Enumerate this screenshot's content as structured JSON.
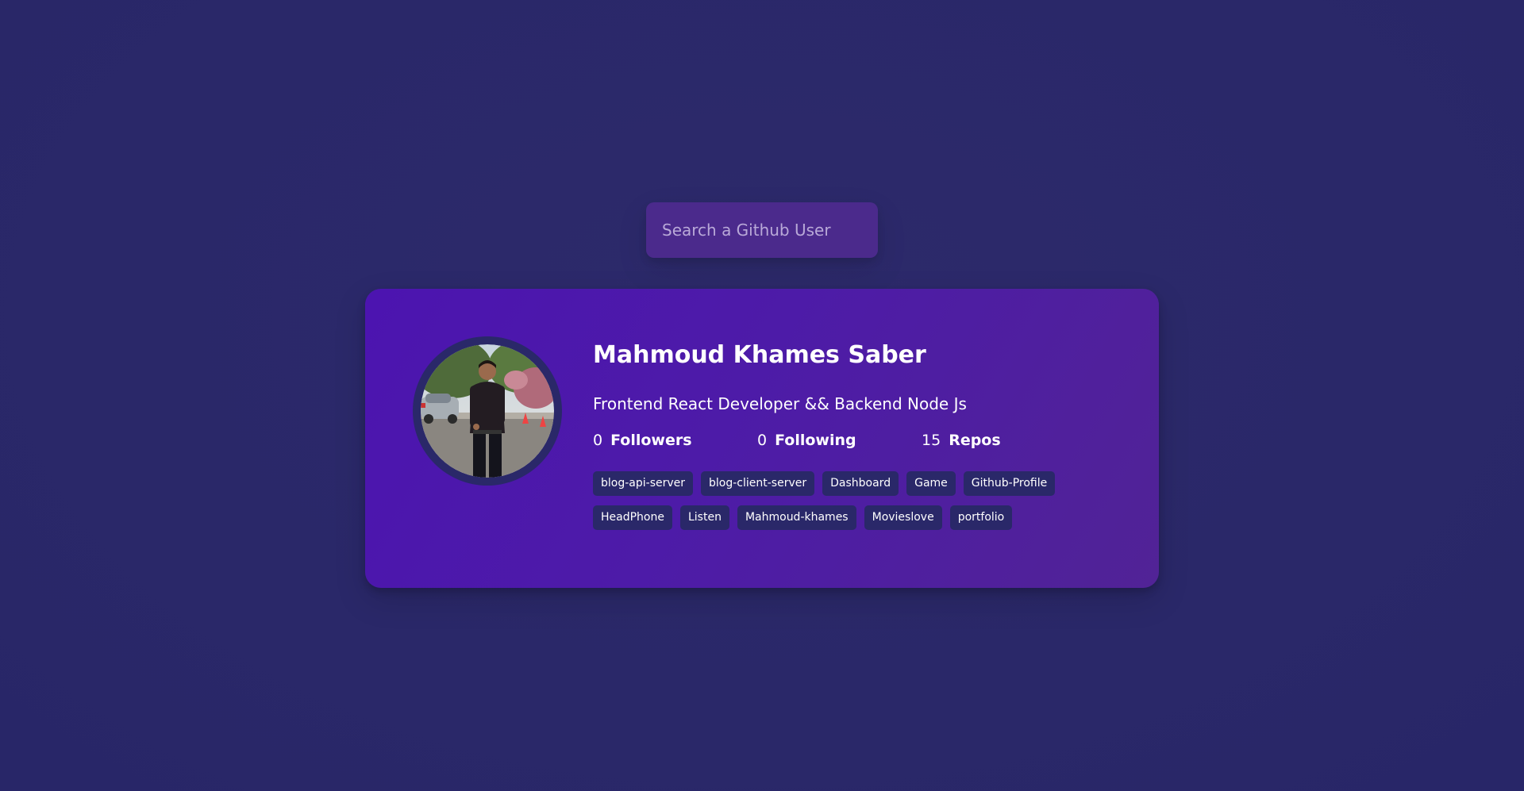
{
  "search": {
    "placeholder": "Search a Github User",
    "value": ""
  },
  "profile": {
    "name": "Mahmoud Khames Saber",
    "bio": "Frontend React Developer && Backend Node Js",
    "stats": [
      {
        "value": "0",
        "label": "Followers"
      },
      {
        "value": "0",
        "label": "Following"
      },
      {
        "value": "15",
        "label": "Repos"
      }
    ],
    "repos": [
      "blog-api-server",
      "blog-client-server",
      "Dashboard",
      "Game",
      "Github-Profile",
      "HeadPhone",
      "Listen",
      "Mahmoud-khames",
      "Movieslove",
      "portfolio"
    ]
  },
  "colors": {
    "background": "#2a2869",
    "card_gradient_start": "#4c14b0",
    "card_gradient_end": "#512396",
    "search_bg": "#4b2a8c",
    "repo_tag_bg": "#2a2869",
    "text": "#ffffff"
  }
}
